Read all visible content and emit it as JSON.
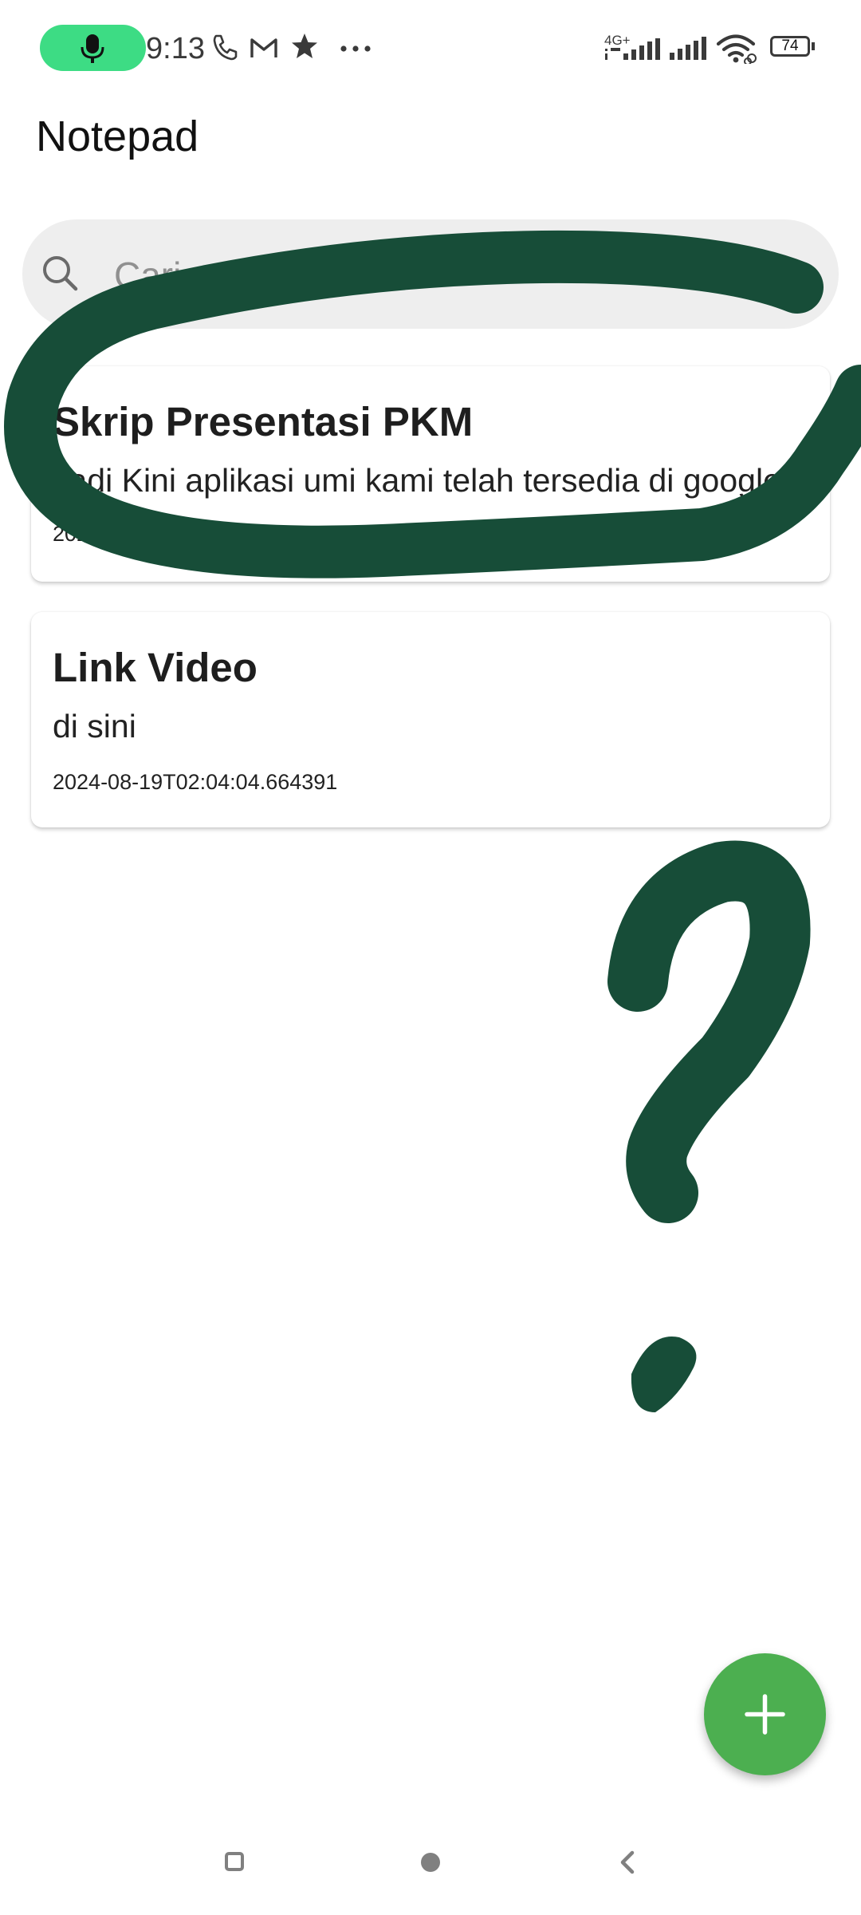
{
  "status_bar": {
    "time": "9:13",
    "network_label": "4G+",
    "battery_level": "74",
    "icons": [
      "mic-icon",
      "phone-icon",
      "gmail-icon",
      "star-icon",
      "more-icon",
      "signal-icon",
      "signal-icon",
      "wifi-icon",
      "battery-icon"
    ]
  },
  "app": {
    "title": "Notepad"
  },
  "search": {
    "placeholder": "Cari catatan"
  },
  "notes": [
    {
      "title": "Skrip Presentasi PKM",
      "body": "Jadi Kini aplikasi umi kami telah tersedia di google",
      "date": "2024-08-19T02:04:04.664391"
    },
    {
      "title": "Link Video",
      "body": "di sini",
      "date": "2024-08-19T02:04:04.664391"
    }
  ],
  "fab": {
    "icon": "plus-icon"
  },
  "nav_bar": {
    "icons": [
      "recents-icon",
      "home-icon",
      "back-icon"
    ]
  },
  "colors": {
    "accent_green": "#4caf50",
    "mic_pill_green": "#3ddc84",
    "scribble_green": "#174d38",
    "search_bg": "#eeeeee"
  }
}
